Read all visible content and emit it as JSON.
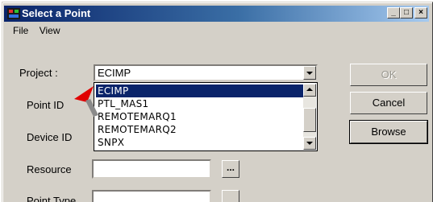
{
  "window": {
    "title": "Select a Point"
  },
  "titlebar_buttons": {
    "minimize": "_",
    "maximize": "□",
    "close": "×"
  },
  "menu": [
    {
      "label": "File"
    },
    {
      "label": "View"
    }
  ],
  "fields": {
    "project_label": "Project :",
    "project_value": "ECIMP",
    "point_id_label": "Point ID",
    "device_id_label": "Device ID",
    "resource_label": "Resource",
    "resource_value": "",
    "point_type_label": "Point Type",
    "ellipsis": "..."
  },
  "dropdown": {
    "items": [
      {
        "label": "ECIMP",
        "selected": true
      },
      {
        "label": "PTL_MAS1",
        "selected": false
      },
      {
        "label": "REMOTEMARQ1",
        "selected": false
      },
      {
        "label": "REMOTEMARQ2",
        "selected": false
      },
      {
        "label": "SNPX",
        "selected": false
      }
    ]
  },
  "buttons": {
    "ok": "OK",
    "cancel": "Cancel",
    "browse": "Browse"
  },
  "colors": {
    "titlebar": "#0a246a",
    "selection": "#0a246a",
    "pointer": "#e00000"
  }
}
